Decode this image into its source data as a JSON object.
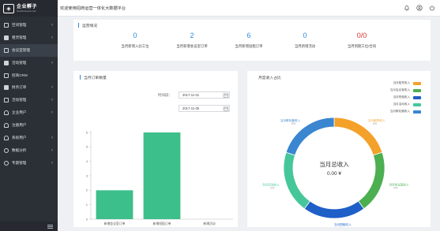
{
  "logo": {
    "name": "企业孵子",
    "sub": "Wowbusiness.com"
  },
  "header": {
    "title": "欢迎使用招商运营一体化大数据平台"
  },
  "sidebar": {
    "items": [
      {
        "label": "空间管理"
      },
      {
        "label": "租赁管理"
      },
      {
        "label": "会议室管理"
      },
      {
        "label": "活动管理"
      },
      {
        "label": "招商CRM"
      },
      {
        "label": "财务订单"
      },
      {
        "label": "活动管理"
      },
      {
        "label": "企业用户"
      },
      {
        "label": "注册用户"
      },
      {
        "label": "系统用户"
      },
      {
        "label": "数据分析"
      },
      {
        "label": "专题管理"
      }
    ]
  },
  "overview": {
    "title": "运营情况",
    "stats": [
      {
        "value": "0",
        "label": "当月新增入驻工位"
      },
      {
        "value": "2",
        "label": "当月新增会议室订单"
      },
      {
        "value": "6",
        "label": "当月新增短租订单"
      },
      {
        "value": "0",
        "label": "当月新增活动"
      },
      {
        "value": "0/0",
        "label": "当月到期工位/合同"
      }
    ]
  },
  "orders": {
    "title": "当月订单数量",
    "period_label": "时间段：",
    "start_date": "2017-11-01",
    "end_date": "2017-11-05"
  },
  "income": {
    "title": "月度收入占比",
    "center_label": "当月总收入",
    "center_value": "0.00 ¥",
    "legend": [
      "当月租赁收入",
      "当月会议室收入",
      "当月短租收入",
      "当月活动收入",
      "当月孵化器收入"
    ]
  },
  "colors": {
    "accent": "#2f88d8",
    "sidebar_bg": "#2b2f36",
    "bar": "#3dbf8c",
    "alert": "#e0302f",
    "pie": [
      "#f4a12a",
      "#4caf50",
      "#1e5fc8",
      "#46c79a",
      "#3a86d0"
    ]
  },
  "chart_data": [
    {
      "type": "bar",
      "title": "当月订单数量",
      "categories": [
        "新增会议室订单",
        "新增短租订单",
        "新增活动"
      ],
      "values": [
        2,
        6,
        0
      ],
      "ylim": [
        0,
        6
      ],
      "yticks": [
        0,
        1,
        2,
        3,
        4,
        5,
        6
      ],
      "grid": false
    },
    {
      "type": "pie",
      "title": "月度收入占比",
      "categories": [
        "当月租赁收入",
        "当月会议室收入",
        "当月短租收入",
        "当月活动收入",
        "当月孵化器收入"
      ],
      "values": [
        0,
        0,
        0,
        0,
        0
      ],
      "slice_labels": [
        "当月租赁收入\n0%",
        "当月会议室收入\n0%",
        "当月短租收入\n0%",
        "当月活动收入\n0%",
        "当月孵化器收入\n0%"
      ],
      "legend": "top-right"
    }
  ]
}
